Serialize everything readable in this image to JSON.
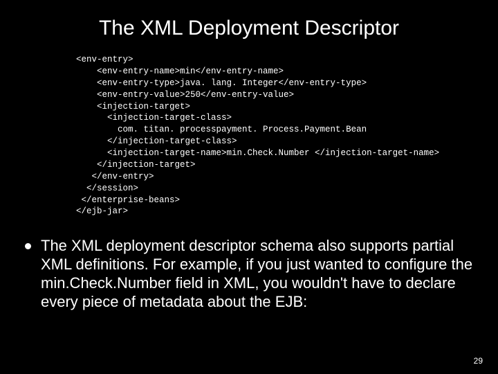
{
  "title": "The XML Deployment Descriptor",
  "code": "<env-entry>\n    <env-entry-name>min</env-entry-name>\n    <env-entry-type>java. lang. Integer</env-entry-type>\n    <env-entry-value>250</env-entry-value>\n    <injection-target>\n      <injection-target-class>\n        com. titan. processpayment. Process.Payment.Bean\n      </injection-target-class>\n      <injection-target-name>min.Check.Number </injection-target-name>\n    </injection-target>\n   </env-entry>\n  </session>\n </enterprise-beans>\n</ejb-jar>",
  "body": "The XML deployment descriptor schema also supports partial XML definitions. For example, if you just wanted to configure the min.Check.Number field in XML, you wouldn't have to declare every piece of metadata about the EJB:",
  "page_number": "29"
}
